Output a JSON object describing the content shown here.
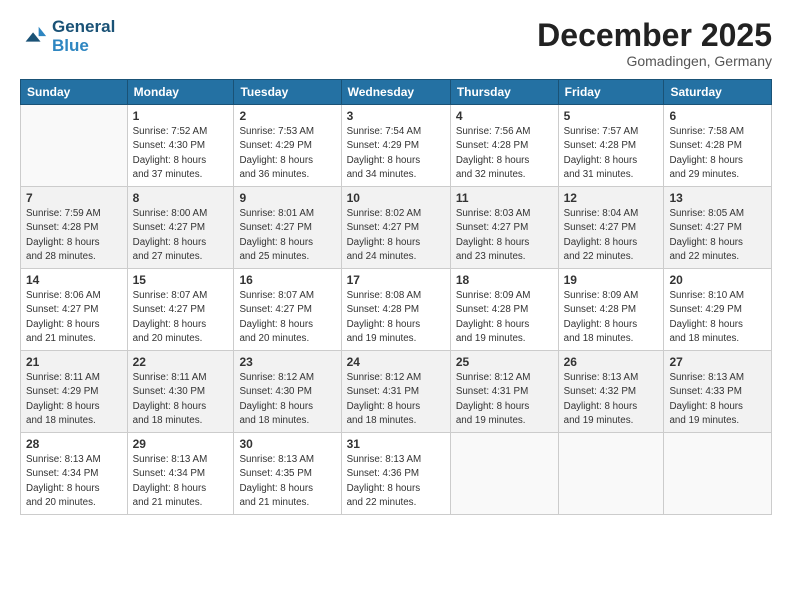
{
  "header": {
    "logo_line1": "General",
    "logo_line2": "Blue",
    "month": "December 2025",
    "location": "Gomadingen, Germany"
  },
  "weekdays": [
    "Sunday",
    "Monday",
    "Tuesday",
    "Wednesday",
    "Thursday",
    "Friday",
    "Saturday"
  ],
  "weeks": [
    [
      {
        "day": "",
        "info": ""
      },
      {
        "day": "1",
        "info": "Sunrise: 7:52 AM\nSunset: 4:30 PM\nDaylight: 8 hours\nand 37 minutes."
      },
      {
        "day": "2",
        "info": "Sunrise: 7:53 AM\nSunset: 4:29 PM\nDaylight: 8 hours\nand 36 minutes."
      },
      {
        "day": "3",
        "info": "Sunrise: 7:54 AM\nSunset: 4:29 PM\nDaylight: 8 hours\nand 34 minutes."
      },
      {
        "day": "4",
        "info": "Sunrise: 7:56 AM\nSunset: 4:28 PM\nDaylight: 8 hours\nand 32 minutes."
      },
      {
        "day": "5",
        "info": "Sunrise: 7:57 AM\nSunset: 4:28 PM\nDaylight: 8 hours\nand 31 minutes."
      },
      {
        "day": "6",
        "info": "Sunrise: 7:58 AM\nSunset: 4:28 PM\nDaylight: 8 hours\nand 29 minutes."
      }
    ],
    [
      {
        "day": "7",
        "info": "Sunrise: 7:59 AM\nSunset: 4:28 PM\nDaylight: 8 hours\nand 28 minutes."
      },
      {
        "day": "8",
        "info": "Sunrise: 8:00 AM\nSunset: 4:27 PM\nDaylight: 8 hours\nand 27 minutes."
      },
      {
        "day": "9",
        "info": "Sunrise: 8:01 AM\nSunset: 4:27 PM\nDaylight: 8 hours\nand 25 minutes."
      },
      {
        "day": "10",
        "info": "Sunrise: 8:02 AM\nSunset: 4:27 PM\nDaylight: 8 hours\nand 24 minutes."
      },
      {
        "day": "11",
        "info": "Sunrise: 8:03 AM\nSunset: 4:27 PM\nDaylight: 8 hours\nand 23 minutes."
      },
      {
        "day": "12",
        "info": "Sunrise: 8:04 AM\nSunset: 4:27 PM\nDaylight: 8 hours\nand 22 minutes."
      },
      {
        "day": "13",
        "info": "Sunrise: 8:05 AM\nSunset: 4:27 PM\nDaylight: 8 hours\nand 22 minutes."
      }
    ],
    [
      {
        "day": "14",
        "info": "Sunrise: 8:06 AM\nSunset: 4:27 PM\nDaylight: 8 hours\nand 21 minutes."
      },
      {
        "day": "15",
        "info": "Sunrise: 8:07 AM\nSunset: 4:27 PM\nDaylight: 8 hours\nand 20 minutes."
      },
      {
        "day": "16",
        "info": "Sunrise: 8:07 AM\nSunset: 4:27 PM\nDaylight: 8 hours\nand 20 minutes."
      },
      {
        "day": "17",
        "info": "Sunrise: 8:08 AM\nSunset: 4:28 PM\nDaylight: 8 hours\nand 19 minutes."
      },
      {
        "day": "18",
        "info": "Sunrise: 8:09 AM\nSunset: 4:28 PM\nDaylight: 8 hours\nand 19 minutes."
      },
      {
        "day": "19",
        "info": "Sunrise: 8:09 AM\nSunset: 4:28 PM\nDaylight: 8 hours\nand 18 minutes."
      },
      {
        "day": "20",
        "info": "Sunrise: 8:10 AM\nSunset: 4:29 PM\nDaylight: 8 hours\nand 18 minutes."
      }
    ],
    [
      {
        "day": "21",
        "info": "Sunrise: 8:11 AM\nSunset: 4:29 PM\nDaylight: 8 hours\nand 18 minutes."
      },
      {
        "day": "22",
        "info": "Sunrise: 8:11 AM\nSunset: 4:30 PM\nDaylight: 8 hours\nand 18 minutes."
      },
      {
        "day": "23",
        "info": "Sunrise: 8:12 AM\nSunset: 4:30 PM\nDaylight: 8 hours\nand 18 minutes."
      },
      {
        "day": "24",
        "info": "Sunrise: 8:12 AM\nSunset: 4:31 PM\nDaylight: 8 hours\nand 18 minutes."
      },
      {
        "day": "25",
        "info": "Sunrise: 8:12 AM\nSunset: 4:31 PM\nDaylight: 8 hours\nand 19 minutes."
      },
      {
        "day": "26",
        "info": "Sunrise: 8:13 AM\nSunset: 4:32 PM\nDaylight: 8 hours\nand 19 minutes."
      },
      {
        "day": "27",
        "info": "Sunrise: 8:13 AM\nSunset: 4:33 PM\nDaylight: 8 hours\nand 19 minutes."
      }
    ],
    [
      {
        "day": "28",
        "info": "Sunrise: 8:13 AM\nSunset: 4:34 PM\nDaylight: 8 hours\nand 20 minutes."
      },
      {
        "day": "29",
        "info": "Sunrise: 8:13 AM\nSunset: 4:34 PM\nDaylight: 8 hours\nand 21 minutes."
      },
      {
        "day": "30",
        "info": "Sunrise: 8:13 AM\nSunset: 4:35 PM\nDaylight: 8 hours\nand 21 minutes."
      },
      {
        "day": "31",
        "info": "Sunrise: 8:13 AM\nSunset: 4:36 PM\nDaylight: 8 hours\nand 22 minutes."
      },
      {
        "day": "",
        "info": ""
      },
      {
        "day": "",
        "info": ""
      },
      {
        "day": "",
        "info": ""
      }
    ]
  ]
}
